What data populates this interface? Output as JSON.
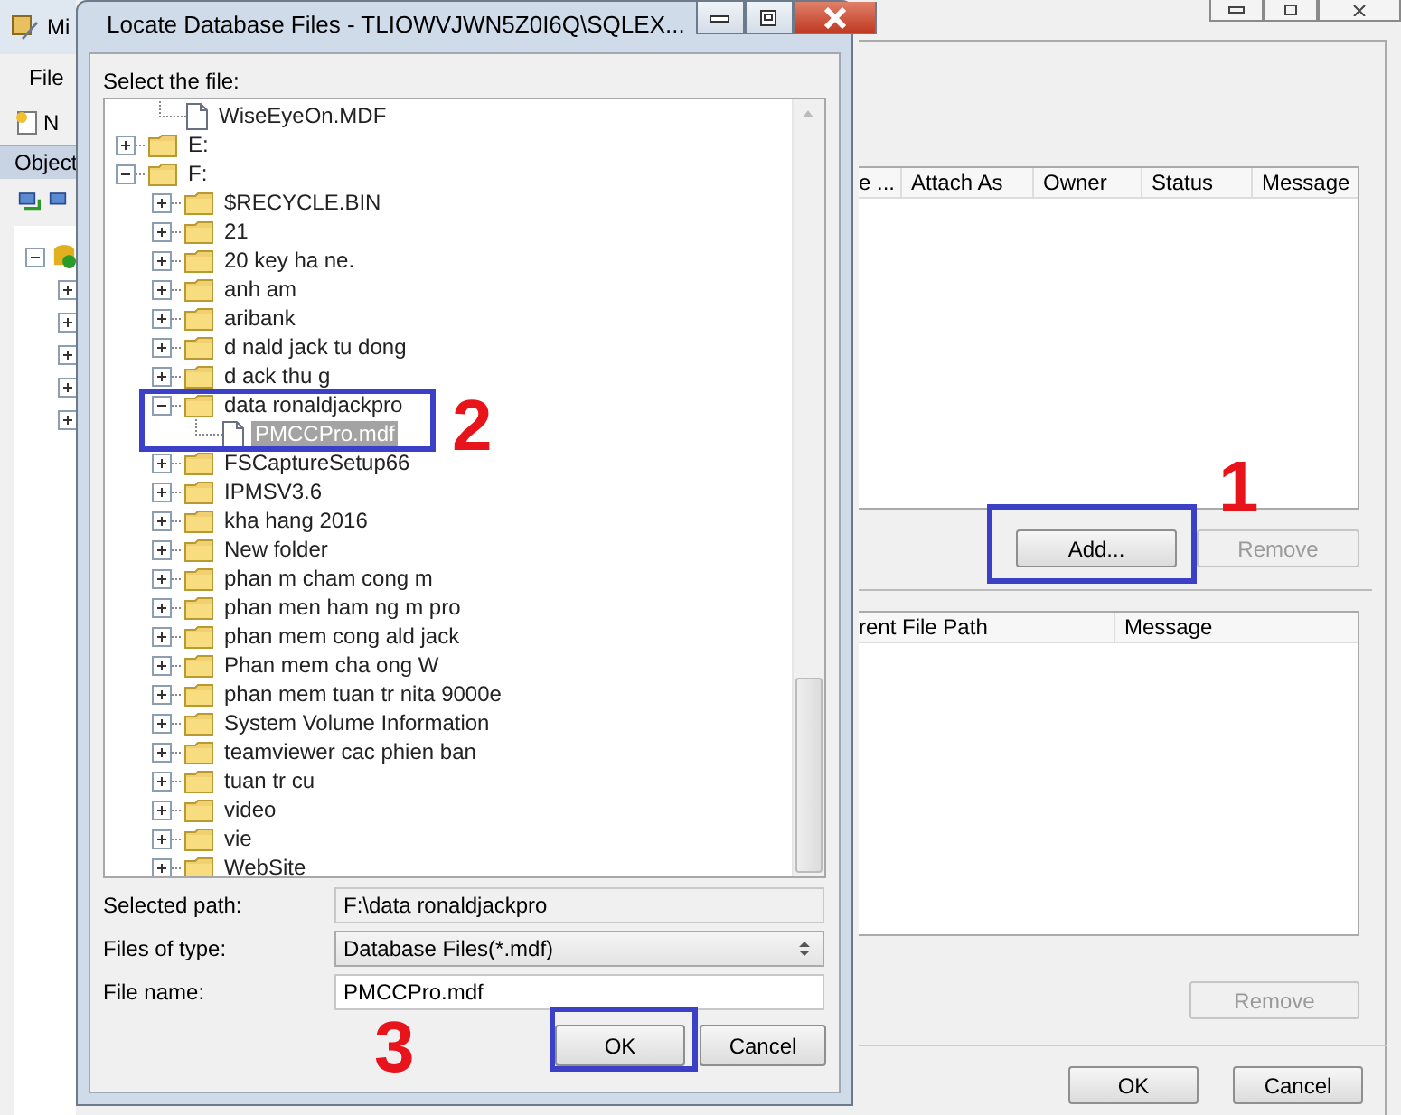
{
  "background_window": {
    "title": "Mi",
    "menu": [
      "File"
    ],
    "toolbar_label": "N",
    "object_explorer": {
      "title": "Object"
    },
    "databases_grid": {
      "columns": [
        "e ...",
        "Attach As",
        "Owner",
        "Status",
        "Message"
      ]
    },
    "add_button": {
      "label": "Add...",
      "disabled": false
    },
    "remove_button": {
      "label": "Remove",
      "disabled": true
    },
    "details_grid": {
      "columns": [
        "rent File Path",
        "Message"
      ]
    },
    "details_remove_button": {
      "label": "Remove",
      "disabled": true
    },
    "buttons": [
      "OK",
      "Cancel"
    ]
  },
  "dialog": {
    "title": "Locate Database Files - TLIOWVJWN5Z0I6Q\\SQLEX...",
    "tree_label": "Select the file:",
    "tree_continued": [
      {
        "label": "WiseEyeOn.MDF",
        "kind": "file",
        "selected": false
      }
    ],
    "tree": [
      {
        "label": "E:",
        "kind": "folder",
        "expanded": false,
        "selected": false
      },
      {
        "label": "F:",
        "kind": "folder",
        "expanded": true,
        "selected": false,
        "children": [
          {
            "label": "$RECYCLE.BIN",
            "kind": "folder",
            "expanded": false,
            "selected": false
          },
          {
            "label": "21",
            "kind": "folder",
            "expanded": false,
            "selected": false
          },
          {
            "label": "20 key ha ne.",
            "kind": "folder",
            "expanded": false,
            "selected": false
          },
          {
            "label": "anh am",
            "kind": "folder",
            "expanded": false,
            "selected": false
          },
          {
            "label": "aribank",
            "kind": "folder",
            "expanded": false,
            "selected": false
          },
          {
            "label": "d nald jack tu dong",
            "kind": "folder",
            "expanded": false,
            "selected": false
          },
          {
            "label": "d ack thu g",
            "kind": "folder",
            "expanded": false,
            "selected": false
          },
          {
            "label": "data ronaldjackpro",
            "kind": "folder",
            "expanded": true,
            "selected": false,
            "children": [
              {
                "label": "PMCCPro.mdf",
                "kind": "file",
                "selected": true
              }
            ]
          },
          {
            "label": "FSCaptureSetup66",
            "kind": "folder",
            "expanded": false,
            "selected": false
          },
          {
            "label": "IPMSV3.6",
            "kind": "folder",
            "expanded": false,
            "selected": false
          },
          {
            "label": "kha hang 2016",
            "kind": "folder",
            "expanded": false,
            "selected": false
          },
          {
            "label": "New folder",
            "kind": "folder",
            "expanded": false,
            "selected": false
          },
          {
            "label": "phan m cham cong m",
            "kind": "folder",
            "expanded": false,
            "selected": false
          },
          {
            "label": "phan men ham ng m pro",
            "kind": "folder",
            "expanded": false,
            "selected": false
          },
          {
            "label": "phan mem cong ald jack",
            "kind": "folder",
            "expanded": false,
            "selected": false
          },
          {
            "label": "Phan mem cha ong W",
            "kind": "folder",
            "expanded": false,
            "selected": false
          },
          {
            "label": "phan mem tuan tr nita 9000e",
            "kind": "folder",
            "expanded": false,
            "selected": false
          },
          {
            "label": "System Volume Information",
            "kind": "folder",
            "expanded": false,
            "selected": false
          },
          {
            "label": "teamviewer cac phien ban",
            "kind": "folder",
            "expanded": false,
            "selected": false
          },
          {
            "label": "tuan tr cu",
            "kind": "folder",
            "expanded": false,
            "selected": false
          },
          {
            "label": "video",
            "kind": "folder",
            "expanded": false,
            "selected": false
          },
          {
            "label": "vie",
            "kind": "folder",
            "expanded": false,
            "selected": false
          },
          {
            "label": "WebSite",
            "kind": "folder",
            "expanded": false,
            "selected": false
          }
        ]
      }
    ],
    "selected_path": {
      "label": "Selected path:",
      "value": "F:\\data ronaldjackpro"
    },
    "files_of_type": {
      "label": "Files of type:",
      "value": "Database Files(*.mdf)"
    },
    "file_name": {
      "label": "File name:",
      "value": "PMCCPro.mdf"
    },
    "buttons": [
      "OK",
      "Cancel"
    ]
  },
  "annotations": [
    {
      "number": "1"
    },
    {
      "number": "2"
    },
    {
      "number": "3"
    }
  ]
}
